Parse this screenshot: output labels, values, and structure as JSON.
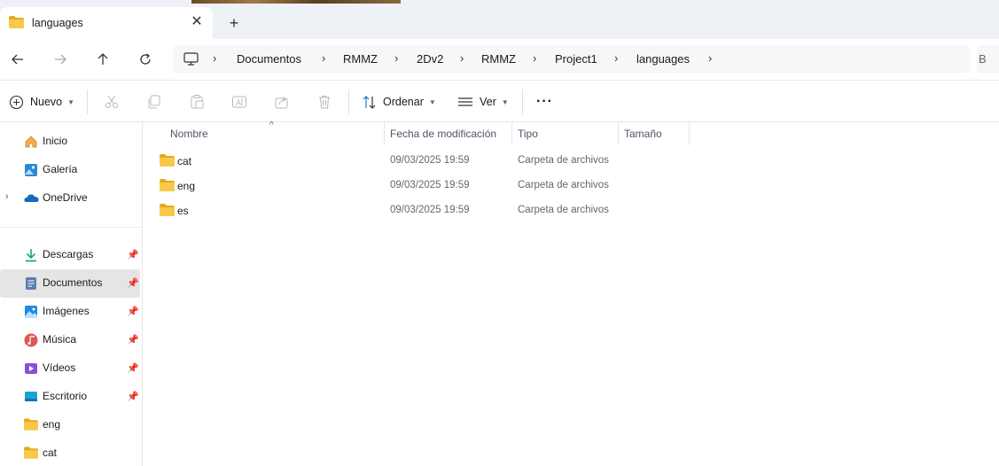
{
  "window": {
    "tab_title": "languages",
    "tab_close": "✕",
    "new_tab": "+"
  },
  "address": {
    "breadcrumb": [
      "Documentos",
      "RMMZ",
      "2Dv2",
      "RMMZ",
      "Project1",
      "languages"
    ],
    "search_partial": "B"
  },
  "toolbar": {
    "new_label": "Nuevo",
    "sort_label": "Ordenar",
    "view_label": "Ver",
    "more_label": "···"
  },
  "sidebar": {
    "items": [
      {
        "label": "Inicio",
        "icon": "home-icon"
      },
      {
        "label": "Galería",
        "icon": "gallery-icon"
      },
      {
        "label": "OneDrive",
        "icon": "onedrive-icon"
      },
      {
        "label": "Descargas",
        "icon": "downloads-icon",
        "pinned": true
      },
      {
        "label": "Documentos",
        "icon": "documents-icon",
        "pinned": true,
        "selected": true
      },
      {
        "label": "Imágenes",
        "icon": "pictures-icon",
        "pinned": true
      },
      {
        "label": "Música",
        "icon": "music-icon",
        "pinned": true
      },
      {
        "label": "Vídeos",
        "icon": "videos-icon",
        "pinned": true
      },
      {
        "label": "Escritorio",
        "icon": "desktop-icon",
        "pinned": true
      },
      {
        "label": "eng",
        "icon": "folder-icon"
      },
      {
        "label": "cat",
        "icon": "folder-icon"
      }
    ]
  },
  "list": {
    "columns": [
      "Nombre",
      "Fecha de modificación",
      "Tipo",
      "Tamaño"
    ],
    "rows": [
      {
        "name": "cat",
        "date": "09/03/2025 19:59",
        "type": "Carpeta de archivos"
      },
      {
        "name": "eng",
        "date": "09/03/2025 19:59",
        "type": "Carpeta de archivos"
      },
      {
        "name": "es",
        "date": "09/03/2025 19:59",
        "type": "Carpeta de archivos"
      }
    ]
  },
  "colors": {
    "folder": "#f7c948",
    "folder_dark": "#e8a91d",
    "accent": "#1a73d9",
    "selected_bg": "#e5e5e5"
  }
}
